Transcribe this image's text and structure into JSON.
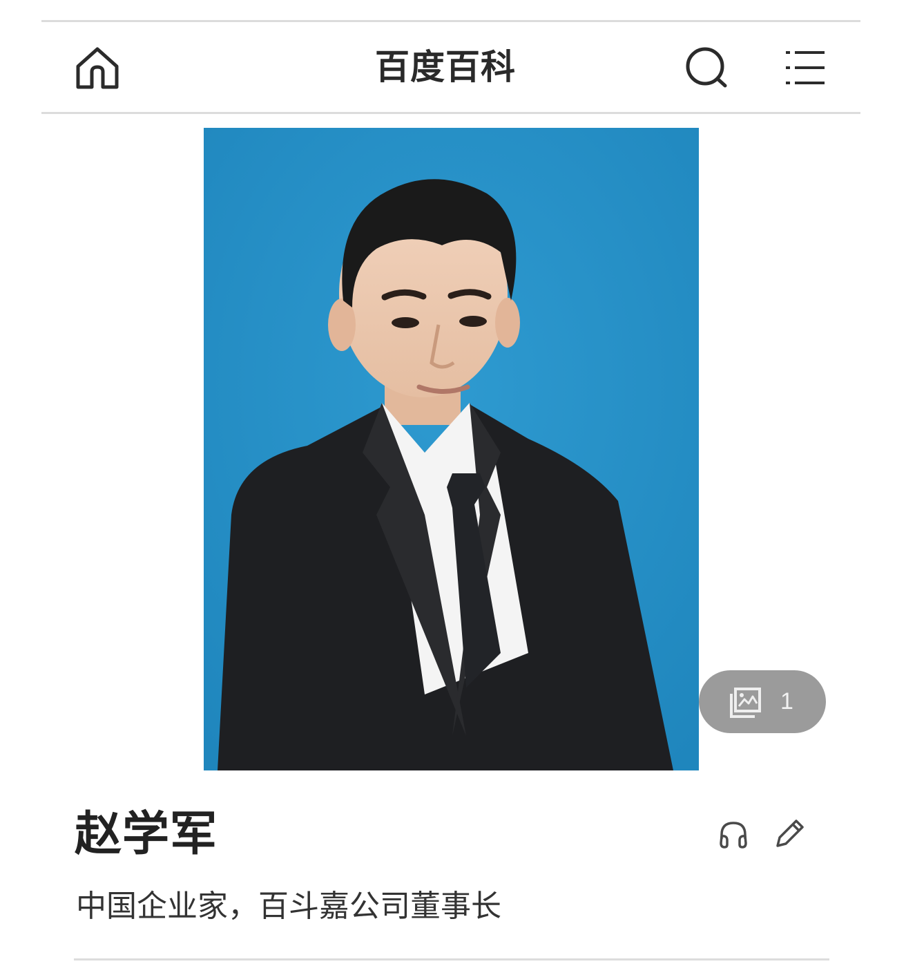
{
  "header": {
    "title": "百度百科",
    "icons": [
      "home-icon",
      "search-icon",
      "menu-icon"
    ]
  },
  "photo": {
    "alt": "",
    "background_color": "#2a93c8"
  },
  "album": {
    "icon": "image-gallery-icon",
    "count": "1"
  },
  "entry": {
    "title": "赵学军",
    "description": "中国企业家，百斗嘉公司董事长",
    "actions": [
      "headphones-icon",
      "edit-pencil-icon"
    ]
  },
  "colors": {
    "text": "#2b2b2b",
    "divider": "#dcdcdc",
    "pill": "#9b9b9b"
  }
}
